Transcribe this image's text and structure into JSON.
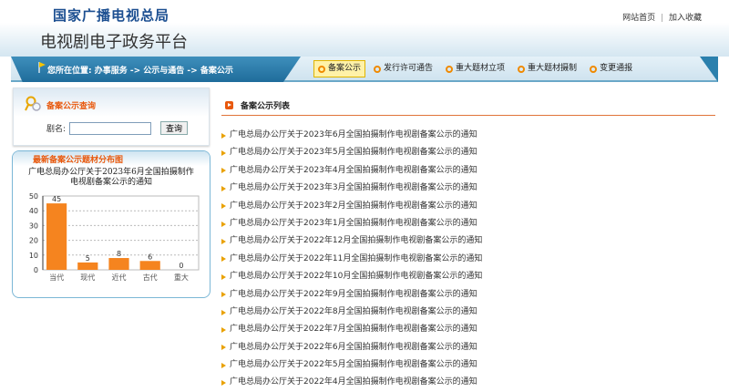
{
  "header": {
    "org": "国家广播电视总局",
    "platform": "电视剧电子政务平台",
    "links": [
      "网站首页",
      "加入收藏"
    ],
    "separator": "|"
  },
  "nav": {
    "breadcrumb": "您所在位置: 办事服务 -> 公示与通告 -> 备案公示",
    "tabs": [
      {
        "label": "备案公示",
        "active": true
      },
      {
        "label": "发行许可通告"
      },
      {
        "label": "重大题材立项"
      },
      {
        "label": "重大题材摄制"
      },
      {
        "label": "变更通报"
      }
    ]
  },
  "search": {
    "title": "备案公示查询",
    "label": "剧名:",
    "value": "",
    "button": "查询"
  },
  "chart_panel": {
    "heading": "最新备案公示题材分布图"
  },
  "chart_data": {
    "type": "bar",
    "title": "广电总局办公厅关于2023年6月全国拍摄制作电视剧备案公示的通知",
    "categories": [
      "当代",
      "现代",
      "近代",
      "古代",
      "重大"
    ],
    "values": [
      45,
      5,
      8,
      6,
      0
    ],
    "yticks": [
      0,
      10,
      20,
      30,
      40,
      50
    ],
    "ylim": [
      0,
      50
    ],
    "grid": true,
    "bar_color": "#f5841f",
    "data_labels": true
  },
  "list": {
    "title": "备案公示列表",
    "items": [
      "广电总局办公厅关于2023年6月全国拍摄制作电视剧备案公示的通知",
      "广电总局办公厅关于2023年5月全国拍摄制作电视剧备案公示的通知",
      "广电总局办公厅关于2023年4月全国拍摄制作电视剧备案公示的通知",
      "广电总局办公厅关于2023年3月全国拍摄制作电视剧备案公示的通知",
      "广电总局办公厅关于2023年2月全国拍摄制作电视剧备案公示的通知",
      "广电总局办公厅关于2023年1月全国拍摄制作电视剧备案公示的通知",
      "广电总局办公厅关于2022年12月全国拍摄制作电视剧备案公示的通知",
      "广电总局办公厅关于2022年11月全国拍摄制作电视剧备案公示的通知",
      "广电总局办公厅关于2022年10月全国拍摄制作电视剧备案公示的通知",
      "广电总局办公厅关于2022年9月全国拍摄制作电视剧备案公示的通知",
      "广电总局办公厅关于2022年8月全国拍摄制作电视剧备案公示的通知",
      "广电总局办公厅关于2022年7月全国拍摄制作电视剧备案公示的通知",
      "广电总局办公厅关于2022年6月全国拍摄制作电视剧备案公示的通知",
      "广电总局办公厅关于2022年5月全国拍摄制作电视剧备案公示的通知",
      "广电总局办公厅关于2022年4月全国拍摄制作电视剧备案公示的通知"
    ]
  }
}
